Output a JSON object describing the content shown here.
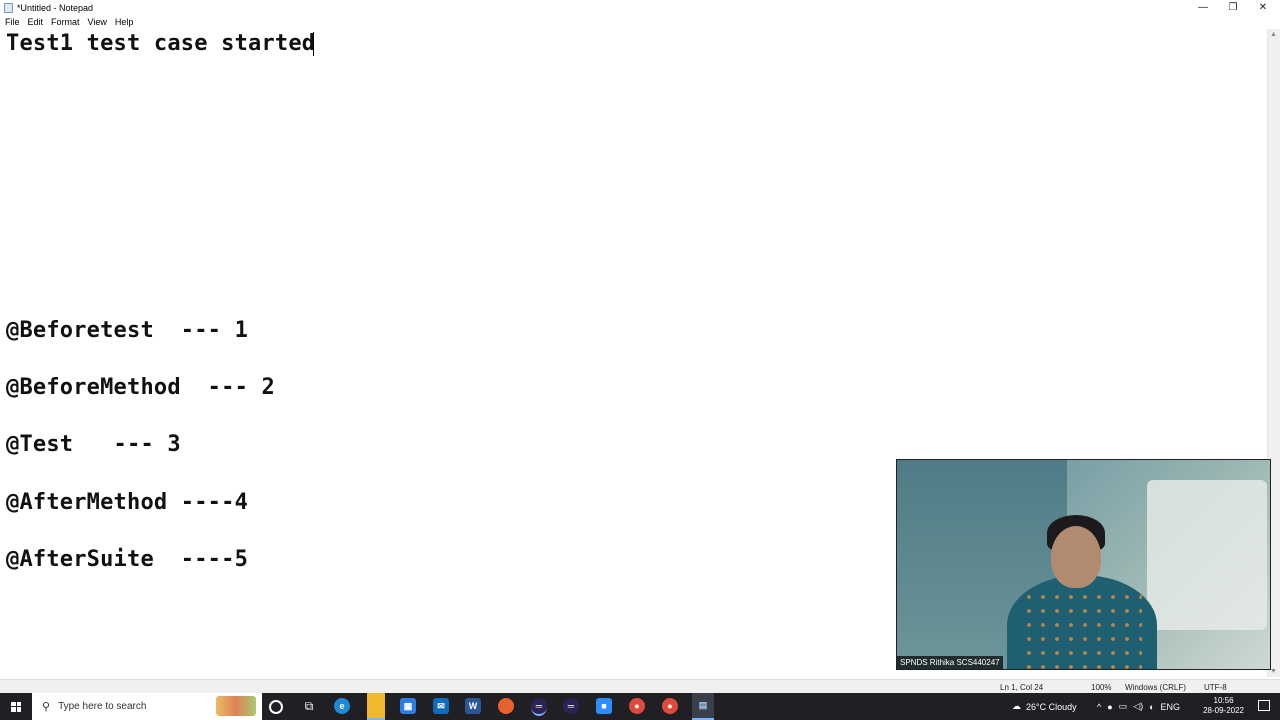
{
  "window": {
    "title": "*Untitled - Notepad",
    "controls": {
      "minimize": "—",
      "maximize": "❐",
      "close": "✕"
    }
  },
  "menu": {
    "items": [
      "File",
      "Edit",
      "Format",
      "View",
      "Help"
    ]
  },
  "editor": {
    "lines": [
      "Test1 test case started",
      "@Beforetest  --- 1",
      "@BeforeMethod  --- 2",
      "@Test   --- 3",
      "@AfterMethod ----4",
      "@AfterSuite  ----5"
    ]
  },
  "video": {
    "caption": "SPNDS Rithika SCS440247"
  },
  "statusbar": {
    "position": "Ln 1, Col 24",
    "zoom": "100%",
    "line_ending": "Windows (CRLF)",
    "encoding": "UTF-8"
  },
  "taskbar": {
    "search_placeholder": "Type here to search",
    "weather": "26°C  Cloudy",
    "language": "ENG",
    "time": "10:56",
    "date": "28-09-2022",
    "apps": [
      "task-view-icon",
      "edge-icon",
      "file-explorer-icon",
      "store-icon",
      "mail-icon",
      "word-icon",
      "firefox-icon",
      "eclipse-icon",
      "eclipse-icon",
      "zoom-icon",
      "chrome-icon",
      "chrome-icon",
      "notepad-icon"
    ]
  }
}
